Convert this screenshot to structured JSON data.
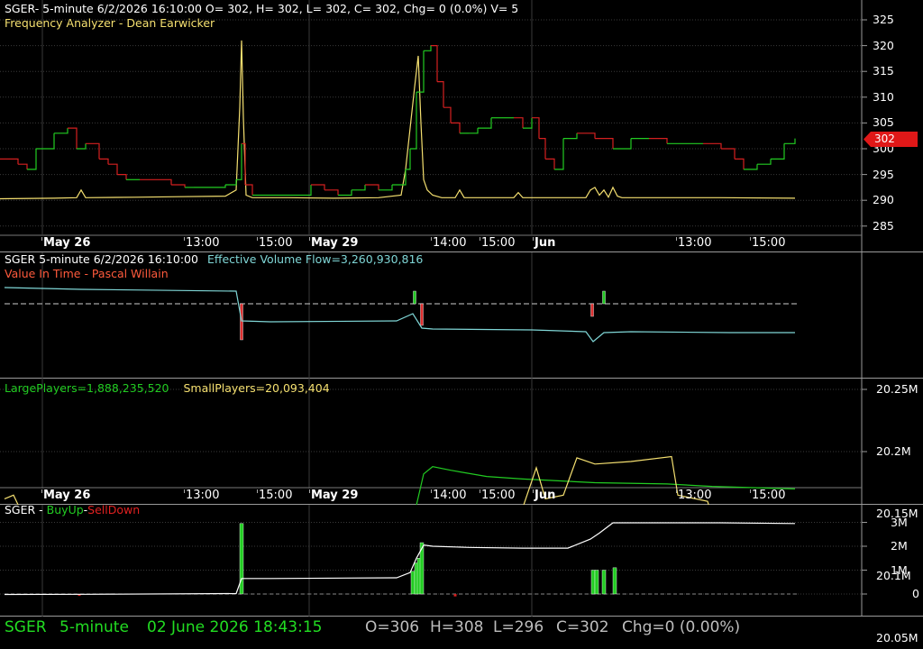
{
  "colors": {
    "green": "#22cc22",
    "red": "#d42020",
    "yellow": "#f5e070",
    "cyan": "#7fd6d6",
    "orange": "#ff5a3c",
    "grid": "#3a3a3a",
    "white": "#ffffff",
    "status_green": "#22dd22",
    "gray": "#bdbdbd"
  },
  "price_pane": {
    "title": "SGER- 5-minute 6/2/2026 16:10:00 O= 302, H= 302, L= 302, C= 302, Chg= 0 (0.0%) V= 5",
    "indicator": "Frequency Analyzer - Dean Earwicker",
    "y_ticks": [
      "325",
      "320",
      "315",
      "310",
      "305",
      "300",
      "295",
      "290",
      "285"
    ],
    "last_price_tag": "302"
  },
  "x_axis_labels": [
    {
      "text": "May 26",
      "bold": true
    },
    {
      "text": "13:00",
      "bold": false
    },
    {
      "text": "15:00",
      "bold": false
    },
    {
      "text": "May 29",
      "bold": true
    },
    {
      "text": "14:00",
      "bold": false
    },
    {
      "text": "15:00",
      "bold": false
    },
    {
      "text": "Jun",
      "bold": true
    },
    {
      "text": "13:00",
      "bold": false
    },
    {
      "text": "15:00",
      "bold": false
    }
  ],
  "flow_pane": {
    "title": "SGER 5-minute  6/2/2026 16:10:00",
    "evf_label": "Effective Volume Flow=3,260,930,816",
    "indicator": "Value In Time - Pascal Willain"
  },
  "players_pane": {
    "large_label": "LargePlayers=1,888,235,520",
    "small_label": "SmallPlayers=20,093,404",
    "y_ticks": [
      "20.25M",
      "20.2M",
      "20.15M",
      "20.1M",
      "20.05M"
    ]
  },
  "buy_pane": {
    "prefix": "SGER - ",
    "buy_label": "BuyUp",
    "separator": "-",
    "sell_label": "SellDown",
    "y_ticks": [
      "3M",
      "2M",
      "1M",
      "0"
    ]
  },
  "status_bar": {
    "symbol": "SGER",
    "interval": "5-minute",
    "datetime": "02 June 2026 18:43:15",
    "open": "O=306",
    "high": "H=308",
    "low": "L=296",
    "close": "C=302",
    "change": "Chg=0 (0.00%)"
  },
  "chart_data": [
    {
      "type": "line",
      "title": "SGER- 5-minute 6/2/2026 16:10:00",
      "ylim": [
        282,
        327
      ],
      "series": [
        {
          "name": "Frequency Analyzer - Dean Earwicker",
          "values": [
            [
              0,
              290.3
            ],
            [
              60,
              290.4
            ],
            [
              85,
              290.5
            ],
            [
              90,
              292
            ],
            [
              95,
              290.5
            ],
            [
              150,
              290.6
            ],
            [
              200,
              290.7
            ],
            [
              250,
              290.8
            ],
            [
              262,
              292
            ],
            [
              266,
              308
            ],
            [
              268,
              321
            ],
            [
              270,
              306
            ],
            [
              273,
              291
            ],
            [
              280,
              290.5
            ],
            [
              320,
              290.5
            ],
            [
              370,
              290.4
            ],
            [
              420,
              290.5
            ],
            [
              445,
              291
            ],
            [
              450,
              296
            ],
            [
              455,
              304
            ],
            [
              460,
              312
            ],
            [
              464,
              318
            ],
            [
              467,
              305
            ],
            [
              470,
              294
            ],
            [
              474,
              292
            ],
            [
              480,
              291
            ],
            [
              490,
              290.5
            ],
            [
              505,
              290.5
            ],
            [
              510,
              292
            ],
            [
              515,
              290.5
            ],
            [
              570,
              290.5
            ],
            [
              575,
              291.5
            ],
            [
              580,
              290.5
            ],
            [
              640,
              290.5
            ],
            [
              650,
              290.5
            ],
            [
              655,
              292
            ],
            [
              660,
              292.5
            ],
            [
              665,
              291
            ],
            [
              670,
              292
            ],
            [
              675,
              290.6
            ],
            [
              680,
              292.5
            ],
            [
              685,
              290.8
            ],
            [
              690,
              290.5
            ],
            [
              740,
              290.5
            ],
            [
              800,
              290.5
            ],
            [
              882,
              290.4
            ]
          ]
        },
        {
          "values": [
            [
              0,
              298
            ],
            [
              20,
              297
            ],
            [
              30,
              296
            ],
            [
              40,
              300
            ],
            [
              60,
              303
            ],
            [
              75,
              304
            ],
            [
              85,
              300
            ],
            [
              95,
              301
            ],
            [
              110,
              298
            ],
            [
              120,
              297
            ],
            [
              130,
              295
            ],
            [
              140,
              294
            ],
            [
              155,
              294
            ],
            [
              190,
              293
            ],
            [
              205,
              292.5
            ],
            [
              215,
              292.5
            ],
            [
              235,
              292.5
            ],
            [
              250,
              293
            ],
            [
              262,
              294
            ],
            [
              268,
              301
            ],
            [
              272,
              293
            ],
            [
              280,
              291
            ],
            [
              300,
              291
            ],
            [
              320,
              291
            ],
            [
              345,
              293
            ],
            [
              360,
              292
            ],
            [
              375,
              291
            ],
            [
              390,
              292
            ],
            [
              405,
              293
            ],
            [
              420,
              292
            ],
            [
              435,
              293
            ],
            [
              450,
              296
            ],
            [
              455,
              300
            ],
            [
              462,
              311
            ],
            [
              470,
              319
            ],
            [
              478,
              320
            ],
            [
              485,
              313
            ],
            [
              492,
              308
            ],
            [
              500,
              305
            ],
            [
              510,
              303
            ],
            [
              520,
              303
            ],
            [
              530,
              304
            ],
            [
              545,
              306
            ],
            [
              560,
              306
            ],
            [
              570,
              306
            ],
            [
              580,
              304
            ],
            [
              590,
              306
            ],
            [
              598,
              302
            ],
            [
              605,
              298
            ],
            [
              615,
              296
            ],
            [
              625,
              302
            ],
            [
              640,
              303
            ],
            [
              660,
              302
            ],
            [
              680,
              300
            ],
            [
              700,
              302
            ],
            [
              720,
              302
            ],
            [
              740,
              301
            ],
            [
              760,
              301
            ],
            [
              780,
              301
            ],
            [
              800,
              300
            ],
            [
              815,
              298
            ],
            [
              825,
              296
            ],
            [
              840,
              297
            ],
            [
              855,
              298
            ],
            [
              870,
              301
            ],
            [
              882,
              302
            ]
          ]
        }
      ]
    },
    {
      "type": "line",
      "title": "Value In Time - Pascal Willain",
      "series": [
        {
          "name": "Effective Volume Flow",
          "values": [
            [
              5,
              319
            ],
            [
              90,
              321
            ],
            [
              262,
              323
            ],
            [
              268,
              356
            ],
            [
              300,
              357
            ],
            [
              440,
              356
            ],
            [
              458,
              348
            ],
            [
              468,
              364
            ],
            [
              480,
              365
            ],
            [
              590,
              366
            ],
            [
              650,
              368
            ],
            [
              658,
              379
            ],
            [
              670,
              369
            ],
            [
              700,
              368
            ],
            [
              810,
              369
            ],
            [
              882,
              369
            ]
          ]
        }
      ]
    },
    {
      "type": "line",
      "ylim": [
        20.03,
        20.27
      ],
      "series": [
        {
          "name": "LargePlayers",
          "values": [
            [
              5,
              20.098
            ],
            [
              90,
              20.093
            ],
            [
              250,
              20.092
            ],
            [
              340,
              20.091
            ],
            [
              440,
              20.092
            ],
            [
              455,
              20.135
            ],
            [
              470,
              20.182
            ],
            [
              480,
              20.188
            ],
            [
              500,
              20.185
            ],
            [
              540,
              20.18
            ],
            [
              580,
              20.178
            ],
            [
              660,
              20.175
            ],
            [
              740,
              20.174
            ],
            [
              790,
              20.172
            ],
            [
              882,
              20.17
            ]
          ]
        },
        {
          "name": "SmallPlayers",
          "values": [
            [
              5,
              20.162
            ],
            [
              15,
              20.165
            ],
            [
              30,
              20.142
            ],
            [
              50,
              20.142
            ],
            [
              90,
              20.14
            ],
            [
              150,
              20.143
            ],
            [
              250,
              20.144
            ],
            [
              320,
              20.142
            ],
            [
              390,
              20.135
            ],
            [
              440,
              20.137
            ],
            [
              490,
              20.143
            ],
            [
              540,
              20.148
            ],
            [
              580,
              20.155
            ],
            [
              595,
              20.187
            ],
            [
              605,
              20.162
            ],
            [
              625,
              20.165
            ],
            [
              640,
              20.195
            ],
            [
              660,
              20.19
            ],
            [
              700,
              20.192
            ],
            [
              745,
              20.196
            ],
            [
              752,
              20.165
            ],
            [
              785,
              20.16
            ],
            [
              800,
              20.125
            ],
            [
              815,
              20.099
            ],
            [
              835,
              20.09
            ],
            [
              860,
              20.085
            ],
            [
              870,
              20.092
            ],
            [
              882,
              20.095
            ]
          ]
        }
      ]
    },
    {
      "type": "bar",
      "ylim": [
        -0.4,
        3.4
      ],
      "series": [
        {
          "name": "BuyUp",
          "values": [
            [
              268,
              2.95
            ],
            [
              458,
              0.95
            ],
            [
              462,
              1.3
            ],
            [
              465,
              1.5
            ],
            [
              468,
              2.15
            ],
            [
              658,
              1.0
            ],
            [
              662,
              1.0
            ],
            [
              670,
              1.0
            ],
            [
              682,
              1.1
            ]
          ]
        },
        {
          "name": "SellDown",
          "values": [
            [
              88,
              -0.05
            ],
            [
              505,
              -0.1
            ]
          ]
        },
        {
          "values": [
            [
              5,
              -0.02
            ],
            [
              100,
              -0.01
            ],
            [
              262,
              0.02
            ],
            [
              268,
              0.65
            ],
            [
              300,
              0.65
            ],
            [
              440,
              0.68
            ],
            [
              455,
              0.9
            ],
            [
              462,
              1.5
            ],
            [
              470,
              2.05
            ],
            [
              480,
              2.0
            ],
            [
              520,
              1.95
            ],
            [
              580,
              1.92
            ],
            [
              630,
              1.92
            ],
            [
              655,
              2.3
            ],
            [
              665,
              2.55
            ],
            [
              680,
              2.98
            ],
            [
              800,
              2.98
            ],
            [
              882,
              2.95
            ]
          ]
        }
      ]
    }
  ]
}
